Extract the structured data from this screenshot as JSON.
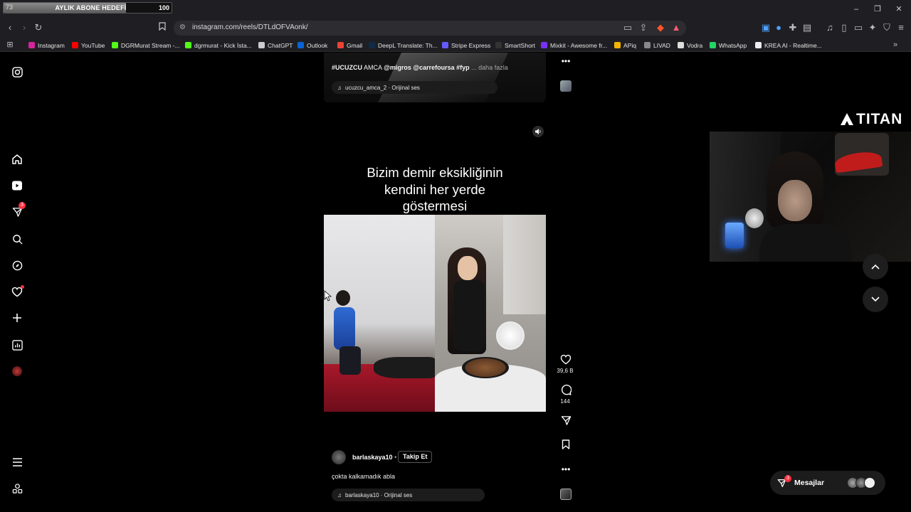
{
  "overlay": {
    "sub_goal": {
      "label": "AYLIK ABONE HEDEFİ",
      "current": "73",
      "target": "100",
      "progress": 0.73
    },
    "titan_logo": "TITAN"
  },
  "browser": {
    "url": "instagram.com/reels/DTLdOFVAonk/",
    "bookmarks": [
      {
        "label": "Instagram",
        "color": "#d6249f"
      },
      {
        "label": "YouTube",
        "color": "#ff0000"
      },
      {
        "label": "DGRMurat Stream -...",
        "color": "#53fc18"
      },
      {
        "label": "dgrmurat - Kick İsta...",
        "color": "#53fc18"
      },
      {
        "label": "ChatGPT",
        "color": "#cccccc"
      },
      {
        "label": "Outlook",
        "color": "#0a64d6"
      },
      {
        "label": "Gmail",
        "color": "#ea4335"
      },
      {
        "label": "DeepL Translate: Th...",
        "color": "#0f2b46"
      },
      {
        "label": "Stripe Express",
        "color": "#635bff"
      },
      {
        "label": "SmartShort",
        "color": "#333333"
      },
      {
        "label": "Mixkit - Awesome fr...",
        "color": "#7b2ff7"
      },
      {
        "label": "APiq",
        "color": "#f4b400"
      },
      {
        "label": "LIVAD",
        "color": "#888888"
      },
      {
        "label": "Vodra",
        "color": "#dddddd"
      },
      {
        "label": "WhatsApp",
        "color": "#25d366"
      },
      {
        "label": "KREA AI - Realtime...",
        "color": "#eeeeee"
      }
    ]
  },
  "prev_reel": {
    "caption_bold": "#UCUZCU",
    "caption_rest": "AMCA",
    "caption_tags": "@migros @carrefoursa #fyp",
    "caption_more": "... daha fazla",
    "audio": "ucuzcu_amca_2 · Orijinal ses"
  },
  "reel": {
    "headline": "Bizim demir eksikliğinin kendini her yerde göstermesi",
    "username": "barlaskaya10",
    "follow_label": "Takip Et",
    "dot": "•",
    "caption": "çokta kalkamadık abla",
    "audio": "barlaskaya10 · Orijinal ses",
    "likes": "39,6 B",
    "comments": "144"
  },
  "messages": {
    "label": "Mesajlar",
    "badge": "3"
  },
  "sidebar": {
    "notifications_badge": "3"
  }
}
